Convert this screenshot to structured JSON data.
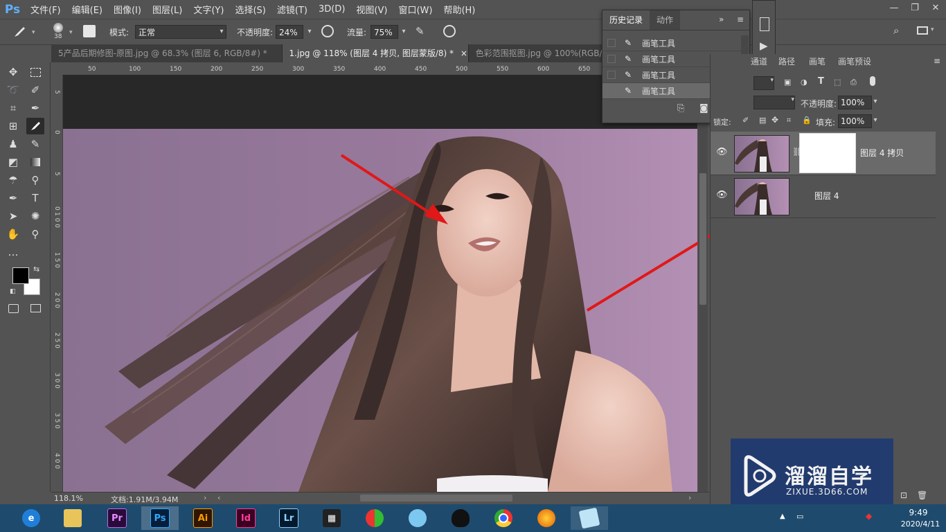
{
  "app": {
    "logo": "Ps"
  },
  "menu": [
    "文件(F)",
    "编辑(E)",
    "图像(I)",
    "图层(L)",
    "文字(Y)",
    "选择(S)",
    "滤镜(T)",
    "3D(D)",
    "视图(V)",
    "窗口(W)",
    "帮助(H)"
  ],
  "window_controls": [
    "—",
    "❐",
    "✕"
  ],
  "options": {
    "brush_size": "38",
    "mode_label": "模式:",
    "mode_value": "正常",
    "opacity_label": "不透明度:",
    "opacity_value": "24%",
    "flow_label": "流量:",
    "flow_value": "75%"
  },
  "tabs": [
    {
      "label": "5产品后期修图-原图.jpg @ 68.3% (图层 6, RGB/8#) *",
      "active": false
    },
    {
      "label": "1.jpg @ 118% (图层 4 拷贝, 图层蒙版/8) *",
      "active": true
    },
    {
      "label": "色彩范围抠图.jpg @ 100%(RGB/8#",
      "active": false
    }
  ],
  "tab_close": "×",
  "ruler_top": [
    "50",
    "100",
    "150",
    "200",
    "250",
    "300",
    "350",
    "400",
    "450",
    "500",
    "550",
    "600",
    "650"
  ],
  "ruler_left": [
    "5",
    "0",
    "5",
    "0",
    "1 0 0",
    "1 5 0",
    "2 0 0",
    "2 5 0",
    "3 0 0",
    "3 5 0",
    "4 0 0"
  ],
  "status": {
    "zoom": "118.1%",
    "doc": "文档:1.91M/3.94M"
  },
  "history": {
    "tabs": [
      "历史记录",
      "动作"
    ],
    "items": [
      "画笔工具",
      "画笔工具",
      "画笔工具",
      "画笔工具"
    ]
  },
  "layers_panel": {
    "tabs": [
      "通道",
      "路径",
      "画笔",
      "画笔预设"
    ],
    "opacity_label": "不透明度:",
    "opacity_value": "100%",
    "fill_label": "填充:",
    "fill_value": "100%",
    "lock_label": "锁定:",
    "layers": [
      {
        "name": "图层 4 拷贝",
        "has_mask": true
      },
      {
        "name": "图层 4",
        "has_mask": false
      }
    ]
  },
  "taskbar": {
    "apps": [
      "IE",
      "Explorer",
      "Pr",
      "Ps",
      "Ai",
      "Id",
      "Lr",
      "Media",
      "Umbrella",
      "Chat",
      "QQ",
      "Chrome",
      "Firefox",
      "Notes"
    ],
    "time": "9:49",
    "date": "2020/4/11"
  },
  "watermark": {
    "title": "溜溜自学",
    "url": "ZIXUE.3D66.COM"
  },
  "colors": {
    "ps_blue": "#31a8ff",
    "photo_bg": "#9a7a9d",
    "arrow": "#e01818",
    "taskbar": "#1e4b6d"
  }
}
